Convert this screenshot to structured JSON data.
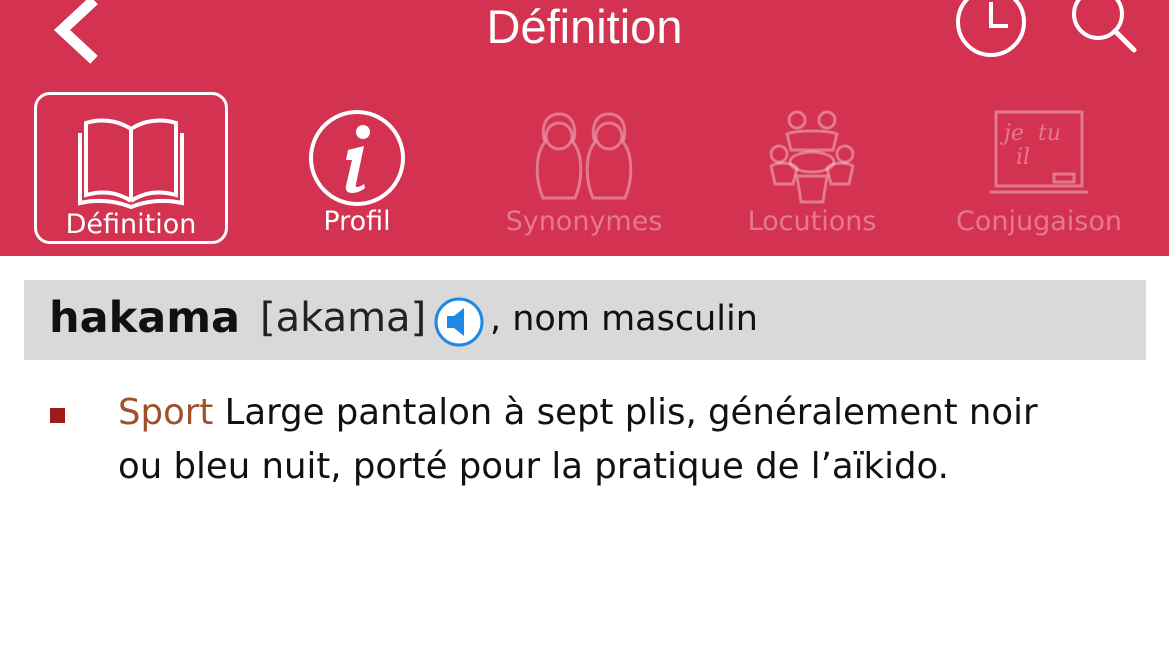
{
  "nav": {
    "title": "Définition",
    "back_icon": "chevron-left-icon",
    "history_icon": "clock-icon",
    "search_icon": "search-icon"
  },
  "tabs": [
    {
      "label": "Définition",
      "icon": "book-icon",
      "state": "active"
    },
    {
      "label": "Profil",
      "icon": "info-icon",
      "state": "enabled"
    },
    {
      "label": "Synonymes",
      "icon": "matryoshka-icon",
      "state": "disabled"
    },
    {
      "label": "Locutions",
      "icon": "people-circle-icon",
      "state": "disabled"
    },
    {
      "label": "Conjugaison",
      "icon": "blackboard-icon",
      "state": "disabled"
    }
  ],
  "entry": {
    "headword": "hakama",
    "phonetic": "[akama]",
    "grammar": ", nom masculin",
    "definitions": [
      {
        "domain": "Sport",
        "text": " Large pantalon à sept plis, généralement noir ou bleu nuit, porté pour la pratique de l’aïkido."
      }
    ]
  },
  "colors": {
    "header_bg": "#d33250",
    "entry_bg": "#d9d9d9",
    "domain": "#a0502a",
    "bullet": "#9b1c1c",
    "speaker": "#1e88e5"
  },
  "icons": {
    "tab_definition": "t",
    "tab_definition_plain": "je",
    "tab_conj_2": "tu",
    "tab_conj_3": "il"
  }
}
